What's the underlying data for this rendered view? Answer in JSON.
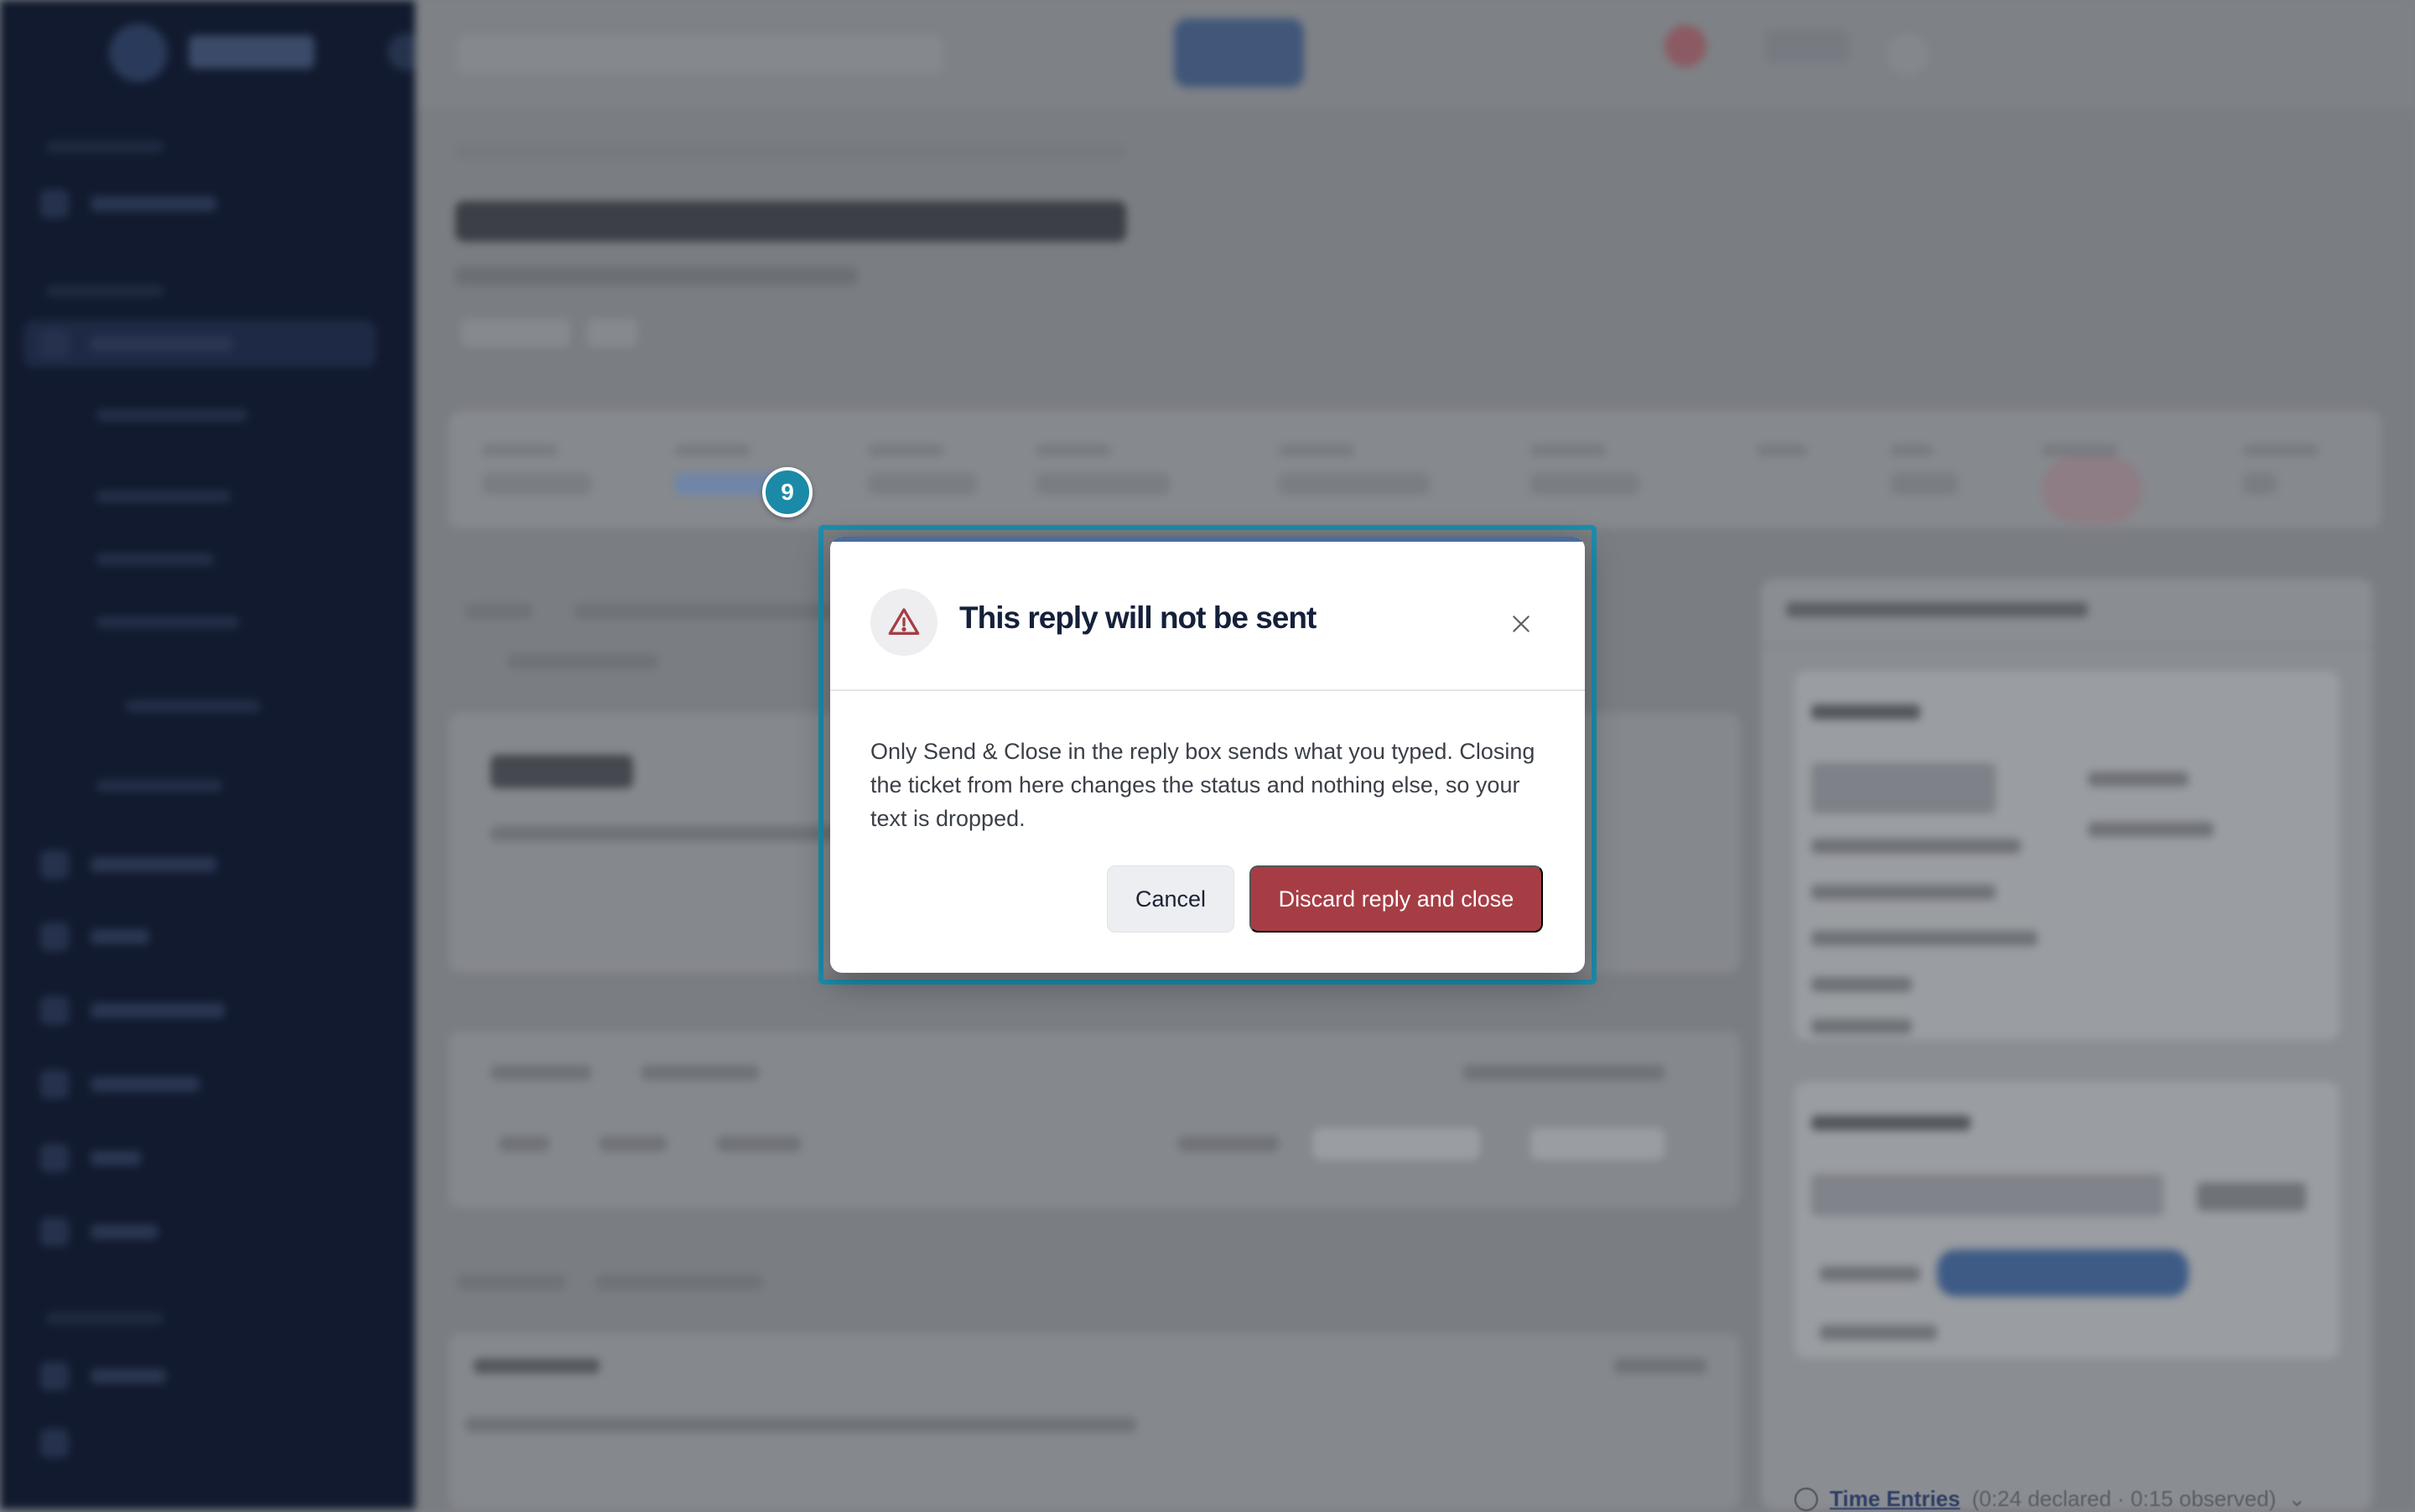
{
  "modal": {
    "step_number": "9",
    "title": "This reply will not be sent",
    "body": "Only Send & Close in the reply box sends what you typed. Closing the ticket from here changes the status and nothing else, so your text is dropped.",
    "cancel_label": "Cancel",
    "confirm_label": "Discard reply and close",
    "colors": {
      "confirm_button": "#a63d45",
      "highlight_frame": "#1b8fae",
      "step_badge": "#1b8aa8"
    },
    "icons": {
      "warning": "warning-triangle-icon",
      "close": "close-icon"
    }
  },
  "background": {
    "time_entries_label": "Time Entries",
    "time_entries_summary": "(0:24 declared · 0:15 observed)"
  }
}
